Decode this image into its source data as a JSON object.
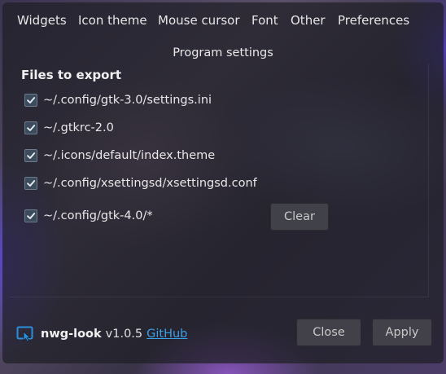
{
  "tabs": [
    {
      "label": "Widgets"
    },
    {
      "label": "Icon theme"
    },
    {
      "label": "Mouse cursor"
    },
    {
      "label": "Font"
    },
    {
      "label": "Other"
    },
    {
      "label": "Preferences"
    }
  ],
  "section": {
    "title": "Program settings"
  },
  "export": {
    "heading": "Files to export",
    "files": [
      {
        "label": "~/.config/gtk-3.0/settings.ini",
        "checked": true
      },
      {
        "label": "~/.gtkrc-2.0",
        "checked": true
      },
      {
        "label": "~/.icons/default/index.theme",
        "checked": true
      },
      {
        "label": "~/.config/xsettingsd/xsettingsd.conf",
        "checked": true
      },
      {
        "label": "~/.config/gtk-4.0/*",
        "checked": true
      }
    ],
    "clear_label": "Clear"
  },
  "footer": {
    "app_icon": "monitor-cursor-icon",
    "app_name": "nwg-look",
    "version": "v1.0.5",
    "link_label": "GitHub",
    "close_label": "Close",
    "apply_label": "Apply"
  },
  "colors": {
    "accent_link": "#3aa0e8",
    "checkbox_fill": "#3d4c5c",
    "check_mark": "#e8f0f8",
    "app_icon": "#2a8fd8"
  }
}
